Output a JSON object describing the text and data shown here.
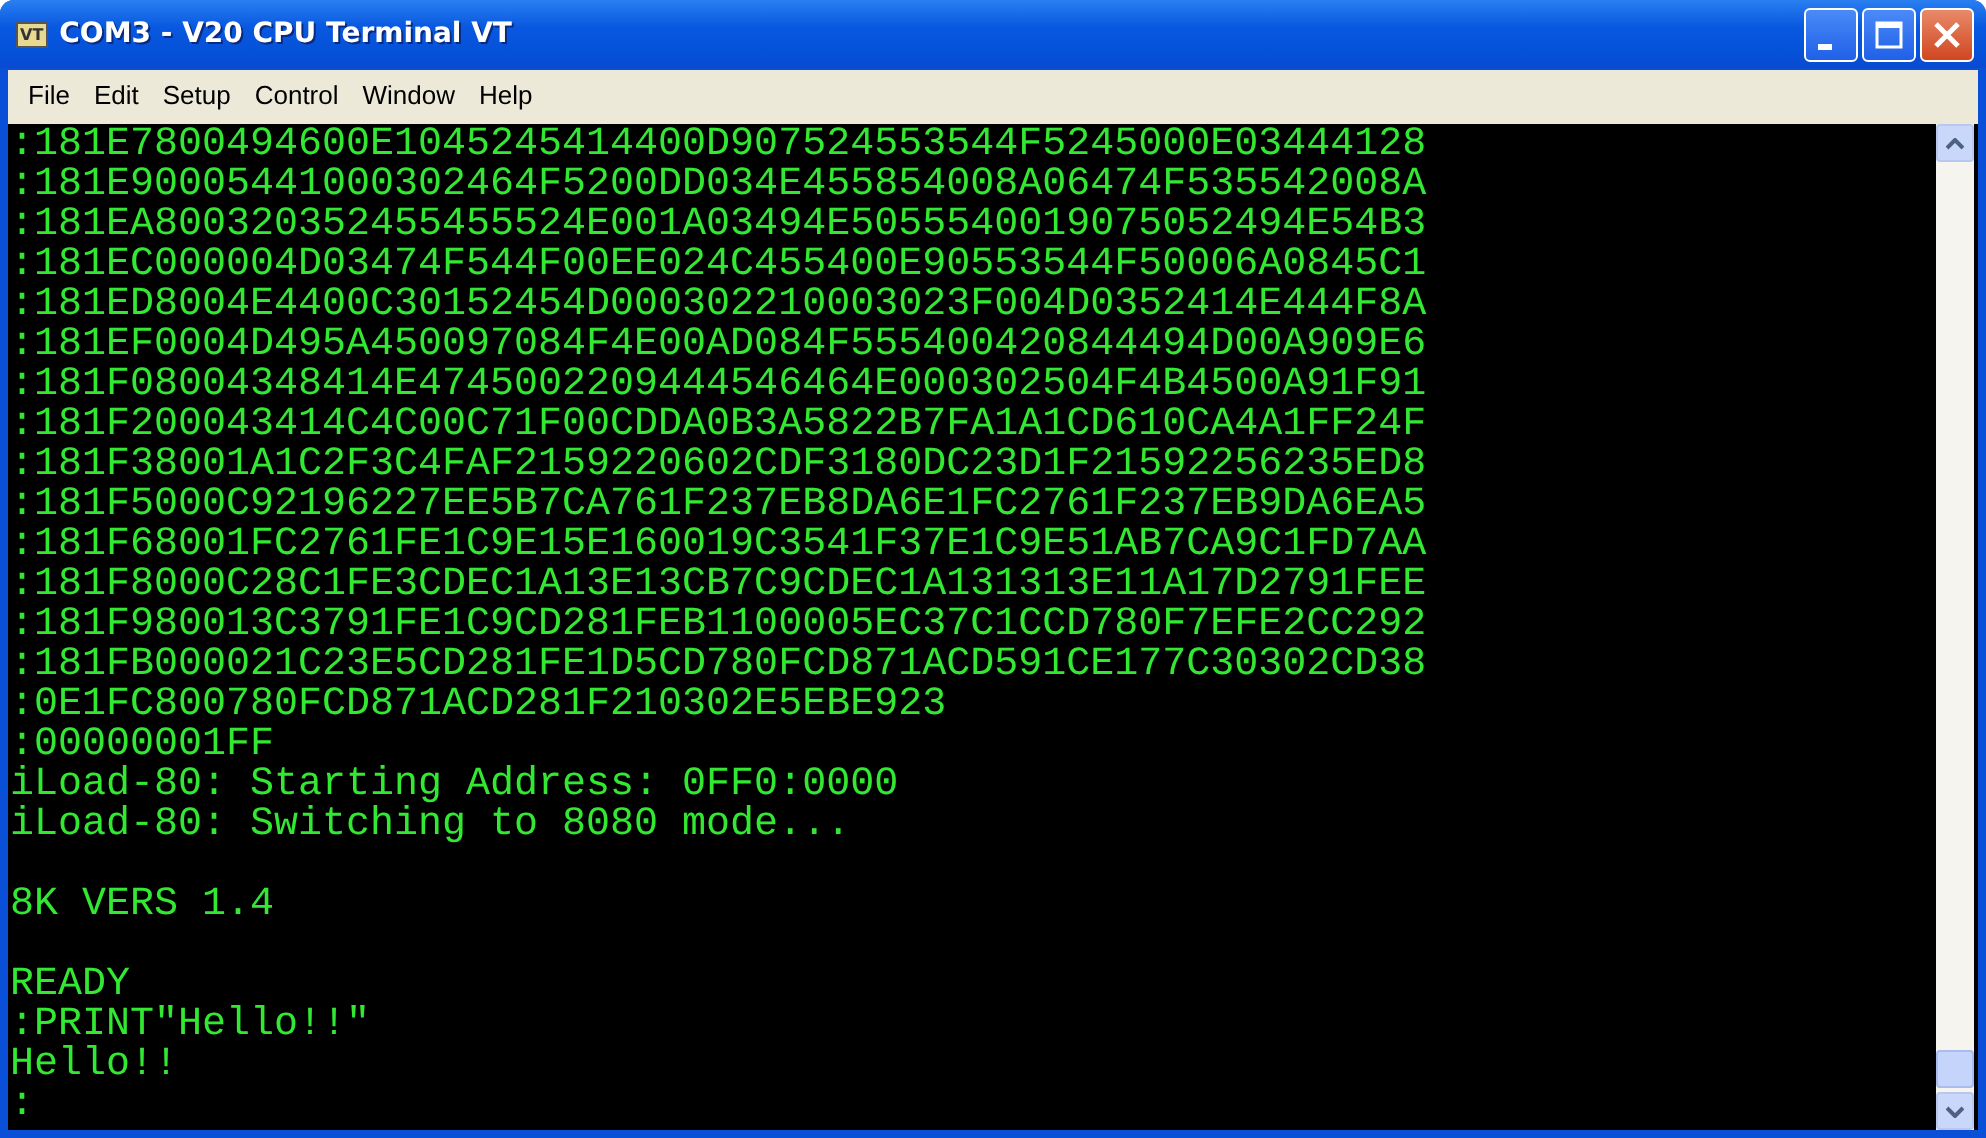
{
  "window": {
    "title": "COM3 - V20 CPU Terminal VT",
    "app_icon_text": "VT"
  },
  "menu": [
    "File",
    "Edit",
    "Setup",
    "Control",
    "Window",
    "Help"
  ],
  "terminal": {
    "blocks": [
      [
        ":181E7800494600E1045245414400D907524553544F5245000E03444128",
        ":181E90005441000302464F5200DD034E455854008A06474F535542008A",
        ":181EA800320352455455524E001A03494E5055540019075052494E54B3",
        ":181EC000004D03474F544F00EE024C455400E90553544F50006A0845C1",
        ":181ED8004E4400C30152454D000302210003023F004D0352414E444F8A",
        ":181EF0004D495A450097084F4E00AD084F555400420844494D00A909E6",
        ":181F08004348414E4745002209444546464E000302504F4B4500A91F91",
        ":181F200043414C4C00C71F00CDDA0B3A5822B7FA1A1CD610CA4A1FF24F",
        ":181F38001A1C2F3C4FAF2159220602CDF3180DC23D1F21592256235ED8",
        ":181F5000C92196227EE5B7CA761F237EB8DA6E1FC2761F237EB9DA6EA5",
        ":181F68001FC2761FE1C9E15E160019C3541F37E1C9E51AB7CA9C1FD7AA",
        ":181F8000C28C1FE3CDEC1A13E13CB7C9CDEC1A131313E11A17D2791FEE",
        ":181F980013C3791FE1C9CD281FEB1100005EC37C1CCD780F7EFE2CC292",
        ":181FB000021C23E5CD281FE1D5CD780FCD871ACD591CE177C30302CD38",
        ":0E1FC800780FCD871ACD281F210302E5EBE923",
        ":00000001FF",
        "iLoad-80: Starting Address: 0FF0:0000",
        "iLoad-80: Switching to 8080 mode..."
      ],
      [
        "8K VERS 1.4"
      ],
      [
        "READY",
        ":PRINT\"Hello!!\"",
        "Hello!!",
        ":"
      ]
    ]
  }
}
